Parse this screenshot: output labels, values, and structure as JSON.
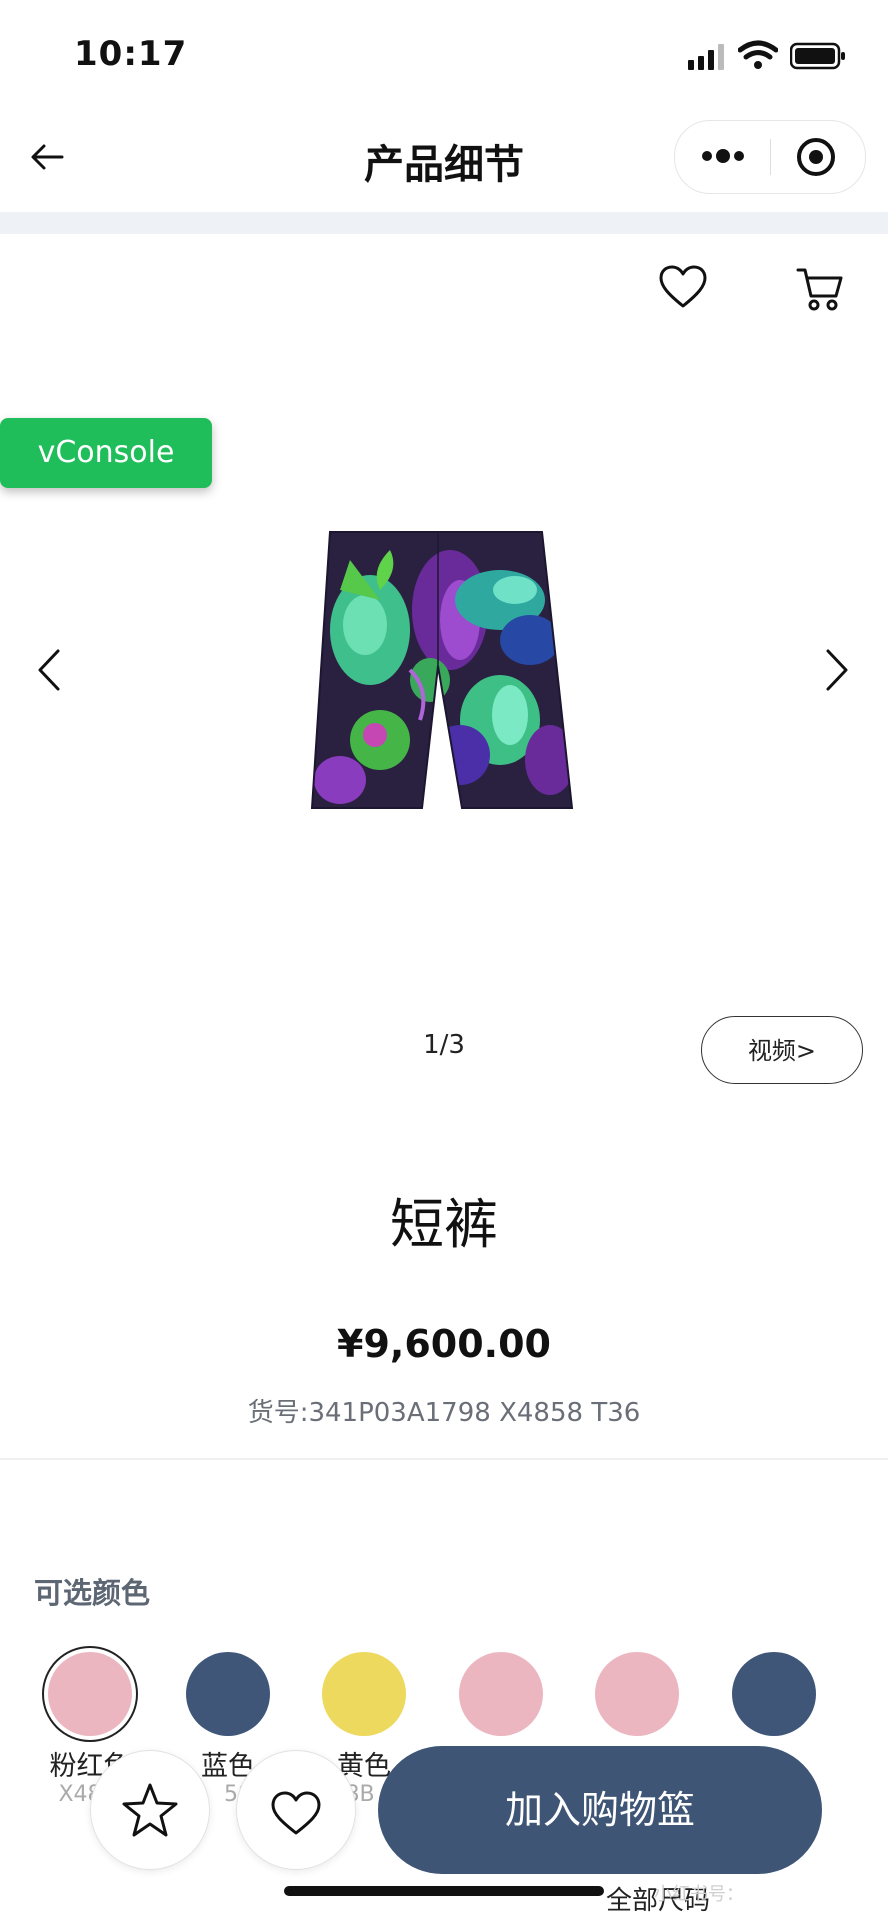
{
  "status_bar": {
    "time": "10:17"
  },
  "nav": {
    "title": "产品细节"
  },
  "debug": {
    "vconsole_label": "vConsole"
  },
  "gallery": {
    "pager": "1/3",
    "video_label": "视频>"
  },
  "product": {
    "name": "短裤",
    "price": "¥9,600.00",
    "sku": "货号:341P03A1798 X4858 T36"
  },
  "colors": {
    "title": "可选颜色",
    "options": [
      {
        "label": "粉红色",
        "sub": "X48",
        "hex": "#ecb6c1",
        "selected": true
      },
      {
        "label": "蓝色",
        "sub": "58",
        "hex": "#3f5679"
      },
      {
        "label": "黄色",
        "sub": "8B",
        "hex": "#ecd95d"
      },
      {
        "label": "",
        "sub": "",
        "hex": "#ecb6c1"
      },
      {
        "label": "",
        "sub": "",
        "hex": "#ecb6c1"
      },
      {
        "label": "",
        "sub": "",
        "hex": "#3f5679"
      }
    ]
  },
  "actions": {
    "add_to_cart": "加入购物篮"
  },
  "footer": {
    "size_all": "全部尺码",
    "watermark": "小红书号："
  },
  "theme": {
    "accent": "#3e5576",
    "vconsole": "#1fbe5a"
  }
}
